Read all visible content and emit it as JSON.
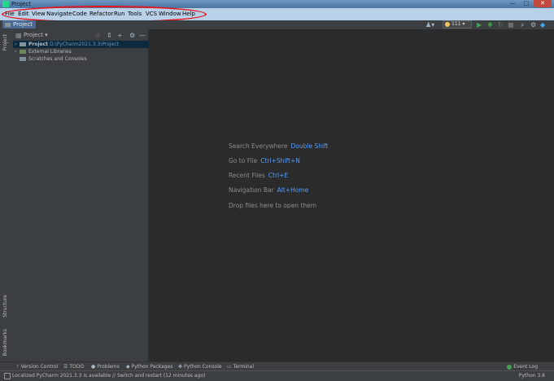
{
  "window": {
    "title": "Project",
    "controls": {
      "minimize": "—",
      "maximize": "▢",
      "close": "✕"
    }
  },
  "menubar": {
    "items": [
      "File",
      "Edit",
      "View",
      "Navigate",
      "Code",
      "Refactor",
      "Run",
      "Tools",
      "VCS",
      "Window",
      "Help"
    ],
    "highlight_color": "#e8141c"
  },
  "breadcrumb": {
    "label": "Project"
  },
  "toolbar": {
    "run_config": "111",
    "run_config_icon": "python-icon"
  },
  "left_strip": {
    "project": "Project",
    "structure": "Structure",
    "bookmarks": "Bookmarks"
  },
  "panel": {
    "title": "Project",
    "tree": [
      {
        "label": "Project",
        "path": "D:\\PyCharm2021.3.3\\Project",
        "selected": true,
        "icon": "folder-icon"
      },
      {
        "label": "External Libraries",
        "path": "",
        "selected": false,
        "icon": "library-icon"
      },
      {
        "label": "Scratches and Consoles",
        "path": "",
        "selected": false,
        "icon": "scratches-icon"
      }
    ]
  },
  "editor_hints": [
    {
      "text": "Search Everywhere",
      "key": "Double Shift"
    },
    {
      "text": "Go to File",
      "key": "Ctrl+Shift+N"
    },
    {
      "text": "Recent Files",
      "key": "Ctrl+E"
    },
    {
      "text": "Navigation Bar",
      "key": "Alt+Home"
    },
    {
      "text": "Drop files here to open them",
      "key": ""
    }
  ],
  "bottom_tabs": [
    "Version Control",
    "TODO",
    "Problems",
    "Python Packages",
    "Python Console",
    "Terminal"
  ],
  "event_log": "Event Log",
  "status": {
    "message": "Localized PyCharm 2021.3.3 is available // Switch and restart (12 minutes ago)",
    "interpreter": "Python 3.8"
  },
  "colors": {
    "accent": "#589df6",
    "selection": "#0d293e",
    "background": "#2b2b2b"
  }
}
